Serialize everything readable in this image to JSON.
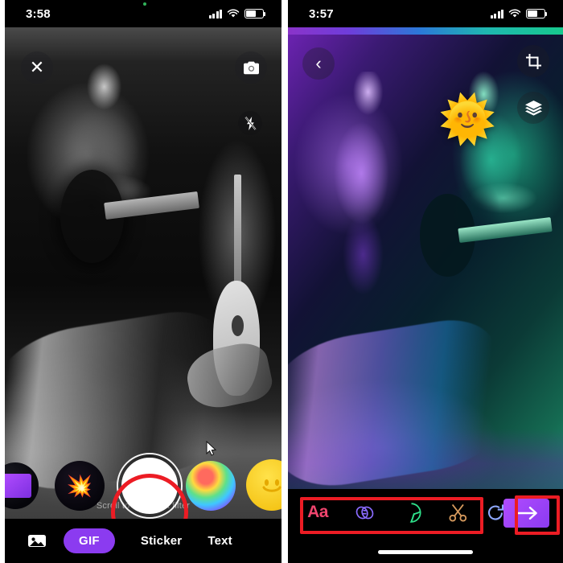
{
  "left_phone": {
    "status_bar": {
      "time": "3:58",
      "cellular_icon": "signal-bars-icon",
      "wifi_icon": "wifi-icon",
      "battery_icon": "battery-icon",
      "recording_indicator": "green-dot-icon"
    },
    "overlay_controls": {
      "close_label": "✕",
      "close_icon": "close-icon",
      "camera_flip_icon": "camera-flip-icon",
      "flash_off_icon": "flash-off-icon"
    },
    "media": {
      "description": "black-and-white photo of a seated musician playing an acoustic guitar on a dark stage with a white acoustic guitar on a stand",
      "filter_name": "black-and-white"
    },
    "filter_carousel": {
      "hint_text": "Scroll to choose a filter",
      "items": [
        {
          "name": "purple-square-filter",
          "glyph": ""
        },
        {
          "name": "sparkle-burst-filter",
          "glyph": "💥"
        },
        {
          "name": "shutter-capture-button",
          "glyph": ""
        },
        {
          "name": "rainbow-swirl-filter",
          "glyph": ""
        },
        {
          "name": "smiley-face-filter",
          "glyph": "🙂"
        }
      ]
    },
    "tab_bar": {
      "gallery_icon": "photo-gallery-icon",
      "tabs": [
        {
          "label": "GIF",
          "selected": true
        },
        {
          "label": "Sticker",
          "selected": false
        },
        {
          "label": "Text",
          "selected": false
        }
      ]
    }
  },
  "right_phone": {
    "status_bar": {
      "time": "3:57",
      "cellular_icon": "signal-bars-icon",
      "wifi_icon": "wifi-icon",
      "battery_icon": "battery-icon"
    },
    "overlay_controls": {
      "back_label": "‹",
      "back_icon": "chevron-left-icon",
      "crop_icon": "crop-icon",
      "layers_icon": "layers-icon"
    },
    "media": {
      "description": "same stage photo recolored with a purple-to-green duotone gradient filter",
      "filter_name": "purple-green-gradient"
    },
    "sticker": {
      "name": "sun-with-face-sticker",
      "glyph": "🌞"
    },
    "edit_toolbar": {
      "tools": [
        {
          "name": "text-tool",
          "label": "Aa",
          "color": "#f0456e"
        },
        {
          "name": "link-tool",
          "label": "",
          "color": "#8a6bff"
        },
        {
          "name": "sticker-tool",
          "label": "",
          "color": "#2fe08a"
        },
        {
          "name": "crop-trim-tool",
          "label": "",
          "color": "#d89b5e"
        }
      ],
      "undo_icon": "redo-icon",
      "send_icon": "arrow-right-icon",
      "send_label": "→"
    },
    "home_indicator": "home-indicator"
  },
  "annotations": {
    "accent_color": "#ec1c24",
    "highlights": [
      {
        "name": "shutter-button-highlight",
        "shape": "circle"
      },
      {
        "name": "edit-tools-highlight",
        "shape": "box"
      },
      {
        "name": "send-button-highlight",
        "shape": "box"
      }
    ]
  },
  "cursor": {
    "name": "mouse-cursor",
    "visible": true
  }
}
